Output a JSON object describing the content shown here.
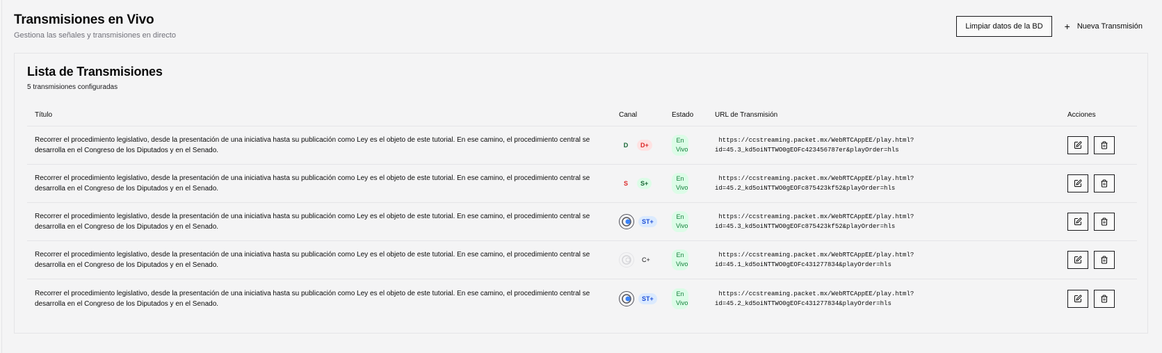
{
  "header": {
    "title": "Transmisiones en Vivo",
    "subtitle": "Gestiona las señales y transmisiones en directo",
    "clear_button": "Limpiar datos de la BD",
    "new_button": "Nueva Transmisión"
  },
  "card": {
    "title": "Lista de Transmisiones",
    "subtitle": "5 transmisiones configuradas"
  },
  "table": {
    "columns": {
      "title": "Título",
      "canal": "Canal",
      "estado": "Estado",
      "url": "URL de Transmisión",
      "actions": "Acciones"
    },
    "rows": [
      {
        "title": "Recorrer el procedimiento legislativo, desde la presentación de una iniciativa hasta su publicación como Ley es el objeto de este tutorial. En ese camino, el procedimiento central se desarrolla en el Congreso de los Diputados y en el Senado.",
        "canal_a": "D",
        "canal_b": "D+",
        "estado": "En Vivo",
        "url_line1": " https://ccstreaming.packet.mx/WebRTCAppEE/play.html?",
        "url_line2": "id=45.3_kd5oiNTTWO0gEOFc423456787er&playOrder=hls"
      },
      {
        "title": "Recorrer el procedimiento legislativo, desde la presentación de una iniciativa hasta su publicación como Ley es el objeto de este tutorial. En ese camino, el procedimiento central se desarrolla en el Congreso de los Diputados y en el Senado.",
        "canal_a": "S",
        "canal_b": "S+",
        "estado": "En Vivo",
        "url_line1": " https://ccstreaming.packet.mx/WebRTCAppEE/play.html?",
        "url_line2": "id=45.2_kd5oiNTTWO0gEOFc875423kf52&playOrder=hls"
      },
      {
        "title": "Recorrer el procedimiento legislativo, desde la presentación de una iniciativa hasta su publicación como Ley es el objeto de este tutorial. En ese camino, el procedimiento central se desarrolla en el Congreso de los Diputados y en el Senado.",
        "canal_b": "ST+",
        "estado": "En Vivo",
        "url_line1": " https://ccstreaming.packet.mx/WebRTCAppEE/play.html?",
        "url_line2": "id=45.3_kd5oiNTTWO0gEOFc875423kf52&playOrder=hls"
      },
      {
        "title": "Recorrer el procedimiento legislativo, desde la presentación de una iniciativa hasta su publicación como Ley es el objeto de este tutorial. En ese camino, el procedimiento central se desarrolla en el Congreso de los Diputados y en el Senado.",
        "canal_b": "C+",
        "estado": "En Vivo",
        "url_line1": " https://ccstreaming.packet.mx/WebRTCAppEE/play.html?",
        "url_line2": "id=45.1_kd5oiNTTWO0gEOFc431277834&playOrder=hls"
      },
      {
        "title": "Recorrer el procedimiento legislativo, desde la presentación de una iniciativa hasta su publicación como Ley es el objeto de este tutorial. En ese camino, el procedimiento central se desarrolla en el Congreso de los Diputados y en el Senado.",
        "canal_b": "ST+",
        "estado": "En Vivo",
        "url_line1": " https://ccstreaming.packet.mx/WebRTCAppEE/play.html?",
        "url_line2": "id=45.2_kd5oiNTTWO0gEOFc431277834&playOrder=hls"
      }
    ]
  },
  "icons": {
    "plus": "plus-icon",
    "edit": "edit-icon",
    "delete": "trash-icon",
    "channel_logo": "channel-logo-icon"
  },
  "colors": {
    "status_bg": "#dcfce7",
    "status_text": "#15803d",
    "badge_d_plus_bg": "#fee2e2",
    "badge_s_plus_bg": "#dcfce7",
    "badge_st_plus_bg": "#dbeafe"
  }
}
